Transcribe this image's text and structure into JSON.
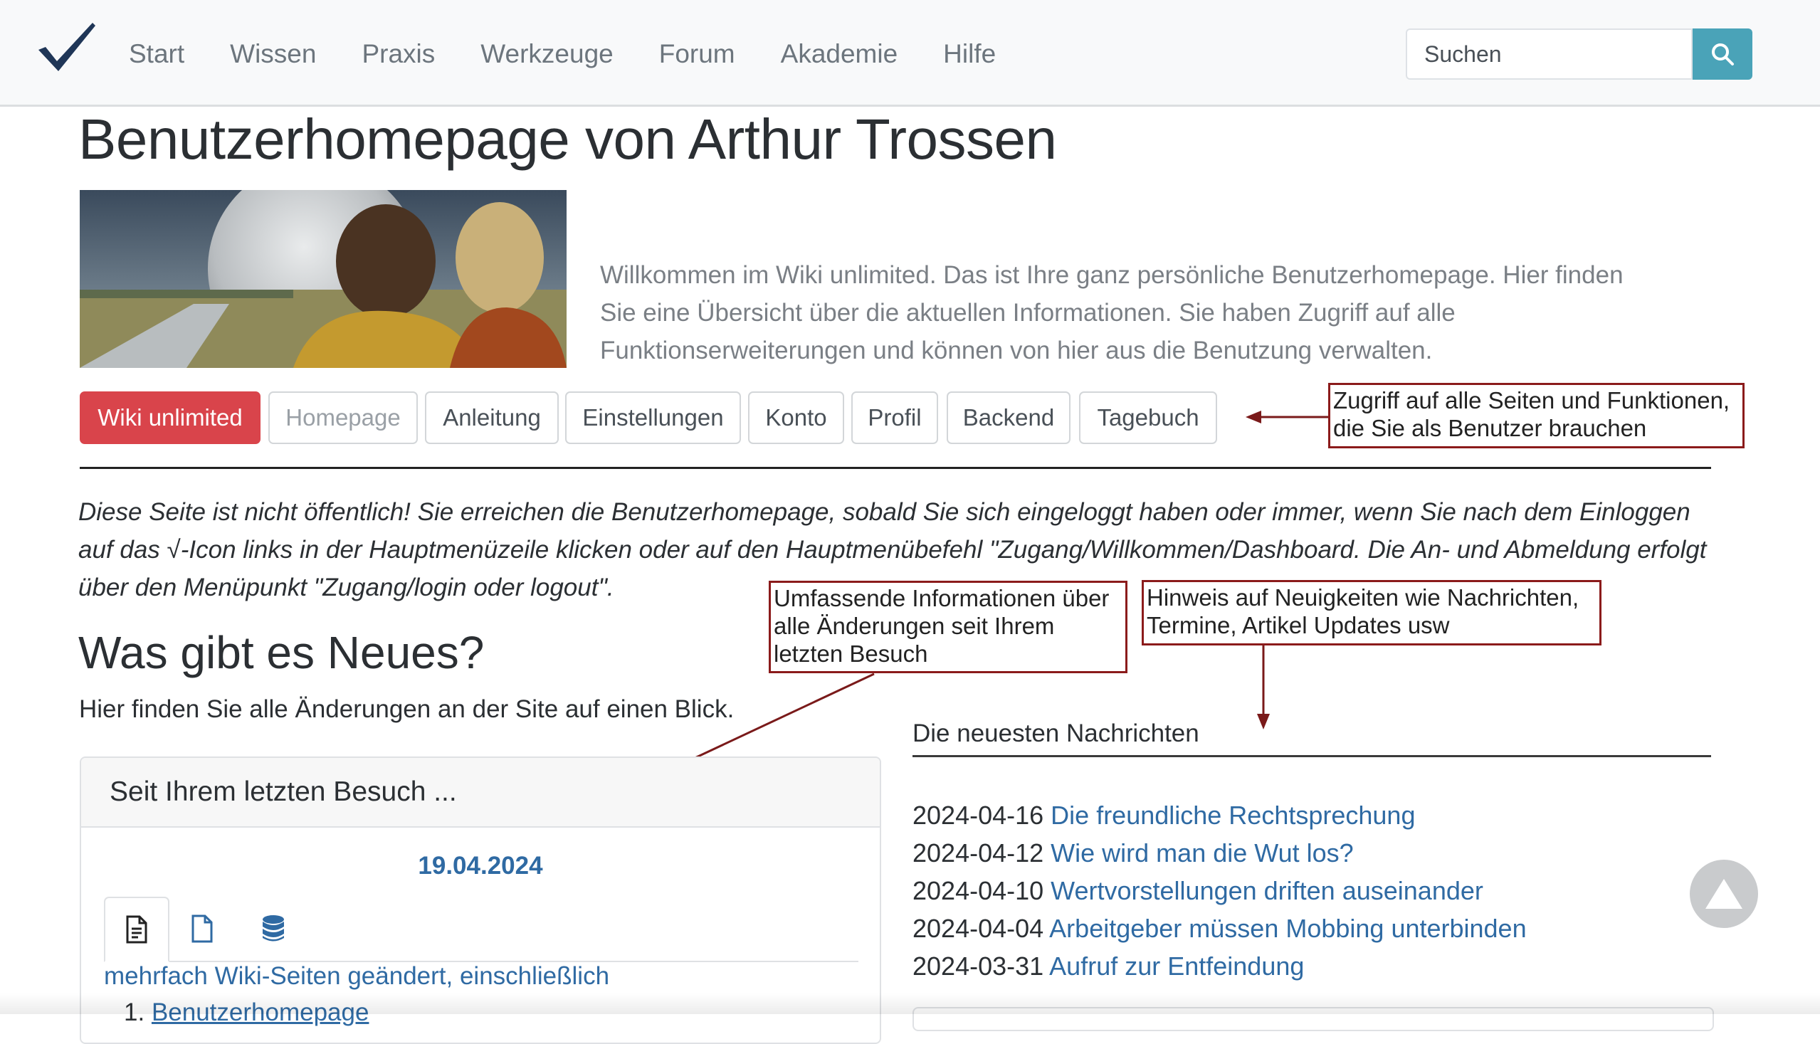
{
  "nav": {
    "items": [
      "Start",
      "Wissen",
      "Praxis",
      "Werkzeuge",
      "Forum",
      "Akademie",
      "Hilfe"
    ],
    "search_placeholder": "Suchen"
  },
  "page": {
    "title": "Benutzerhomepage von Arthur Trossen",
    "intro": "Willkommen im Wiki unlimited. Das ist Ihre ganz persönliche Benutzerhomepage. Hier finden Sie eine Übersicht über die aktuellen Informationen. Sie haben Zugriff auf alle Funktionserweiterungen und können von hier aus die Benutzung verwalten."
  },
  "buttons": [
    "Wiki unlimited",
    "Homepage",
    "Anleitung",
    "Einstellungen",
    "Konto",
    "Profil",
    "Backend",
    "Tagebuch"
  ],
  "annotations": {
    "buttons": "Zugriff auf alle Seiten und Funktionen, die Sie als Benutzer brauchen",
    "changes": "Umfassende Informationen über alle Änderungen seit Ihrem letzten Besuch",
    "news": "Hinweis auf Neuigkeiten wie Nachrichten, Termine, Artikel Updates usw"
  },
  "notice": "Diese Seite ist nicht öffentlich! Sie erreichen die Benutzerhomepage, sobald Sie sich eingeloggt haben oder immer, wenn Sie nach dem Einloggen auf das √-Icon links in der Hauptmenüzeile klicken oder auf den Hauptmenübefehl \"Zugang/Willkommen/Dashboard. Die An- und Abmeldung erfolgt über den Menüpunkt \"Zugang/login oder logout\".",
  "whats_new": {
    "title": "Was gibt es Neues?",
    "subtitle": "Hier finden Sie alle Änderungen an der Site auf einen Blick."
  },
  "last_visit": {
    "header": "Seit Ihrem letzten Besuch ...",
    "date": "19.04.2024",
    "tabs": [
      "document-text-icon",
      "document-icon",
      "database-icon"
    ],
    "summary_link": "mehrfach Wiki-Seiten geändert, einschließlich",
    "first_item_number": "1.",
    "first_item_link": "Benutzerhomepage"
  },
  "news": {
    "title": "Die neuesten Nachrichten",
    "items": [
      {
        "date": "2024-04-16",
        "title": "Die freundliche Rechtsprechung"
      },
      {
        "date": "2024-04-12",
        "title": "Wie wird man die Wut los?"
      },
      {
        "date": "2024-04-10",
        "title": "Wertvorstellungen driften auseinander"
      },
      {
        "date": "2024-04-04",
        "title": "Arbeitgeber müssen Mobbing unterbinden"
      },
      {
        "date": "2024-03-31",
        "title": "Aufruf zur Entfeindung"
      }
    ]
  },
  "colors": {
    "primary_button": "#d9444b",
    "link": "#2f6aa3",
    "search_button": "#4aa3b8",
    "annotation_border": "#8b1b1b",
    "logo": "#1f3657"
  }
}
